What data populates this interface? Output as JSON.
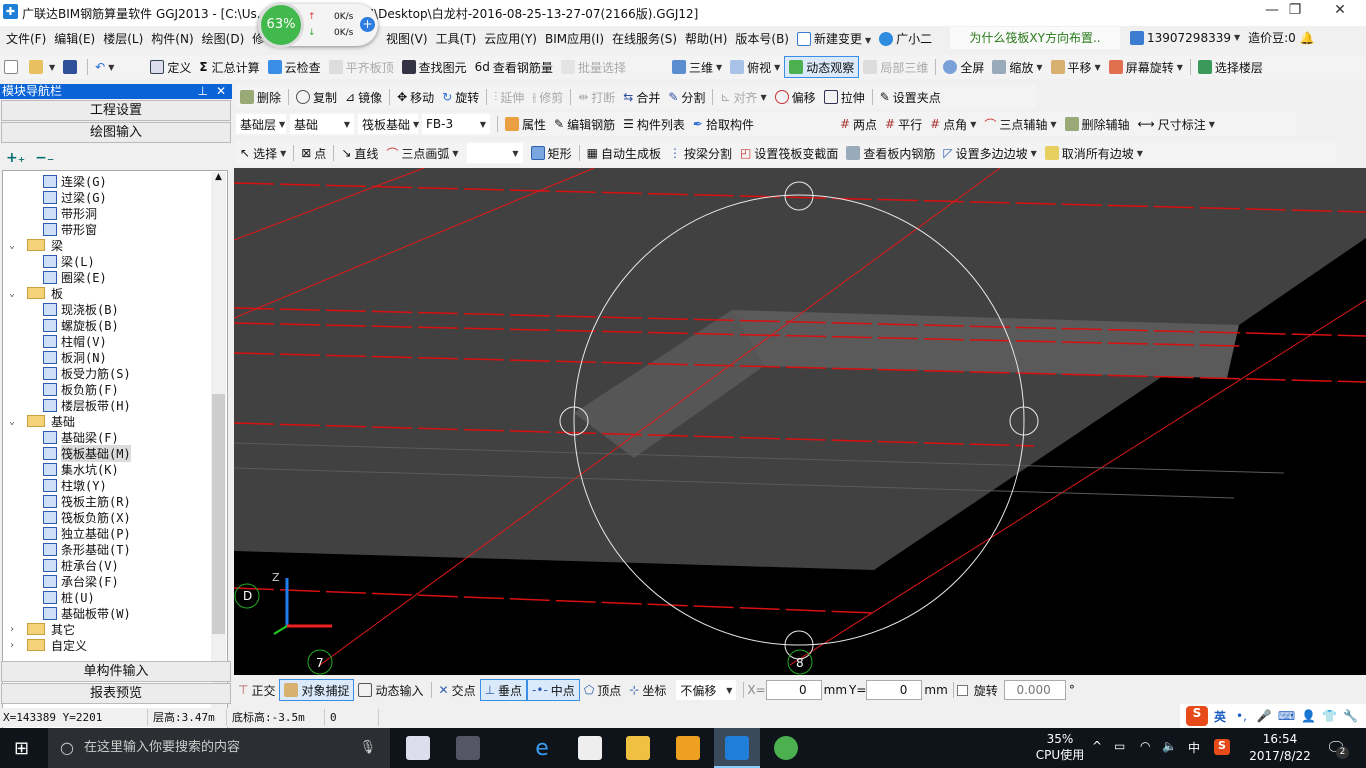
{
  "title": "广联达BIM钢筋算量软件 GGJ2013 - [C:\\Us...                  -20141127NRHM\\Desktop\\白龙村-2016-08-25-13-27-07(2166版).GGJ12]",
  "net_widget": {
    "cpu": "63%",
    "up": "0K/s",
    "down": "0K/s"
  },
  "menu": [
    "文件(F)",
    "编辑(E)",
    "楼层(L)",
    "构件(N)",
    "绘图(D)",
    "修",
    "视图(V)",
    "工具(T)",
    "云应用(Y)",
    "BIM应用(I)",
    "在线服务(S)",
    "帮助(H)",
    "版本号(B)"
  ],
  "menu_extra": {
    "new_change": "新建变更",
    "assistant": "广小二",
    "hint": "为什么筏板XY方向布置..",
    "phone": "13907298339",
    "beans": "造价豆:0"
  },
  "toolbar1": [
    "定义",
    "汇总计算",
    "云检查",
    "平齐板顶",
    "查找图元",
    "查看钢筋量",
    "批量选择",
    "三维",
    "俯视",
    "动态观察",
    "局部三维",
    "全屏",
    "缩放",
    "平移",
    "屏幕旋转",
    "选择楼层"
  ],
  "toolbar2": [
    "删除",
    "复制",
    "镜像",
    "移动",
    "旋转",
    "延伸",
    "修剪",
    "打断",
    "合并",
    "分割",
    "对齐",
    "偏移",
    "拉伸",
    "设置夹点"
  ],
  "selectors": [
    "基础层",
    "基础",
    "筏板基础",
    "FB-3"
  ],
  "toolbar3": [
    "属性",
    "编辑钢筋",
    "构件列表",
    "拾取构件",
    "两点",
    "平行",
    "点角",
    "三点辅轴",
    "删除辅轴",
    "尺寸标注"
  ],
  "toolbar4": [
    "选择",
    "点",
    "直线",
    "三点画弧",
    "",
    "矩形",
    "自动生成板",
    "按梁分割",
    "设置筏板变截面",
    "查看板内钢筋",
    "设置多边边坡",
    "取消所有边坡"
  ],
  "nav": {
    "title": "模块导航栏",
    "tabs": [
      "工程设置",
      "绘图输入"
    ],
    "bottom_tabs": [
      "单构件输入",
      "报表预览"
    ],
    "tree": [
      {
        "label": "连梁(G)",
        "level": 2
      },
      {
        "label": "过梁(G)",
        "level": 2
      },
      {
        "label": "带形洞",
        "level": 2
      },
      {
        "label": "带形窗",
        "level": 2
      },
      {
        "label": "梁",
        "level": 1
      },
      {
        "label": "梁(L)",
        "level": 2
      },
      {
        "label": "圈梁(E)",
        "level": 2
      },
      {
        "label": "板",
        "level": 1
      },
      {
        "label": "现浇板(B)",
        "level": 2
      },
      {
        "label": "螺旋板(B)",
        "level": 2
      },
      {
        "label": "柱帽(V)",
        "level": 2
      },
      {
        "label": "板洞(N)",
        "level": 2
      },
      {
        "label": "板受力筋(S)",
        "level": 2
      },
      {
        "label": "板负筋(F)",
        "level": 2
      },
      {
        "label": "楼层板带(H)",
        "level": 2
      },
      {
        "label": "基础",
        "level": 1
      },
      {
        "label": "基础梁(F)",
        "level": 2
      },
      {
        "label": "筏板基础(M)",
        "level": 2,
        "selected": true
      },
      {
        "label": "集水坑(K)",
        "level": 2
      },
      {
        "label": "柱墩(Y)",
        "level": 2
      },
      {
        "label": "筏板主筋(R)",
        "level": 2
      },
      {
        "label": "筏板负筋(X)",
        "level": 2
      },
      {
        "label": "独立基础(P)",
        "level": 2
      },
      {
        "label": "条形基础(T)",
        "level": 2
      },
      {
        "label": "桩承台(V)",
        "level": 2
      },
      {
        "label": "承台梁(F)",
        "level": 2
      },
      {
        "label": "桩(U)",
        "level": 2
      },
      {
        "label": "基础板带(W)",
        "level": 2
      },
      {
        "label": "其它",
        "level": 1,
        "collapsed": true
      },
      {
        "label": "自定义",
        "level": 1,
        "collapsed": true
      }
    ]
  },
  "viewport": {
    "axis_labels": [
      "D",
      "7",
      "8"
    ],
    "axis_z": "Z"
  },
  "snapbar": {
    "items": [
      "正交",
      "对象捕捉",
      "动态输入",
      "交点",
      "垂点",
      "中点",
      "顶点",
      "坐标"
    ],
    "offset": "不偏移",
    "x_label": "X=",
    "x_value": "0",
    "y_label": "Y=",
    "y_value": "0",
    "unit": "mm",
    "rotate_label": "旋转",
    "rotate_value": "0.000",
    "degree": "°"
  },
  "status": {
    "coords": "X=143389 Y=2201",
    "floor_height": "层高:3.47m",
    "bottom_elev": "底标高:-3.5m",
    "value": "0"
  },
  "ime": {
    "lang": "英"
  },
  "taskbar": {
    "search": "在这里输入你要搜索的内容",
    "cpu": "35%",
    "cpu_label": "CPU使用",
    "ime": "中",
    "time": "16:54",
    "date": "2017/8/22",
    "notifications": "2"
  }
}
